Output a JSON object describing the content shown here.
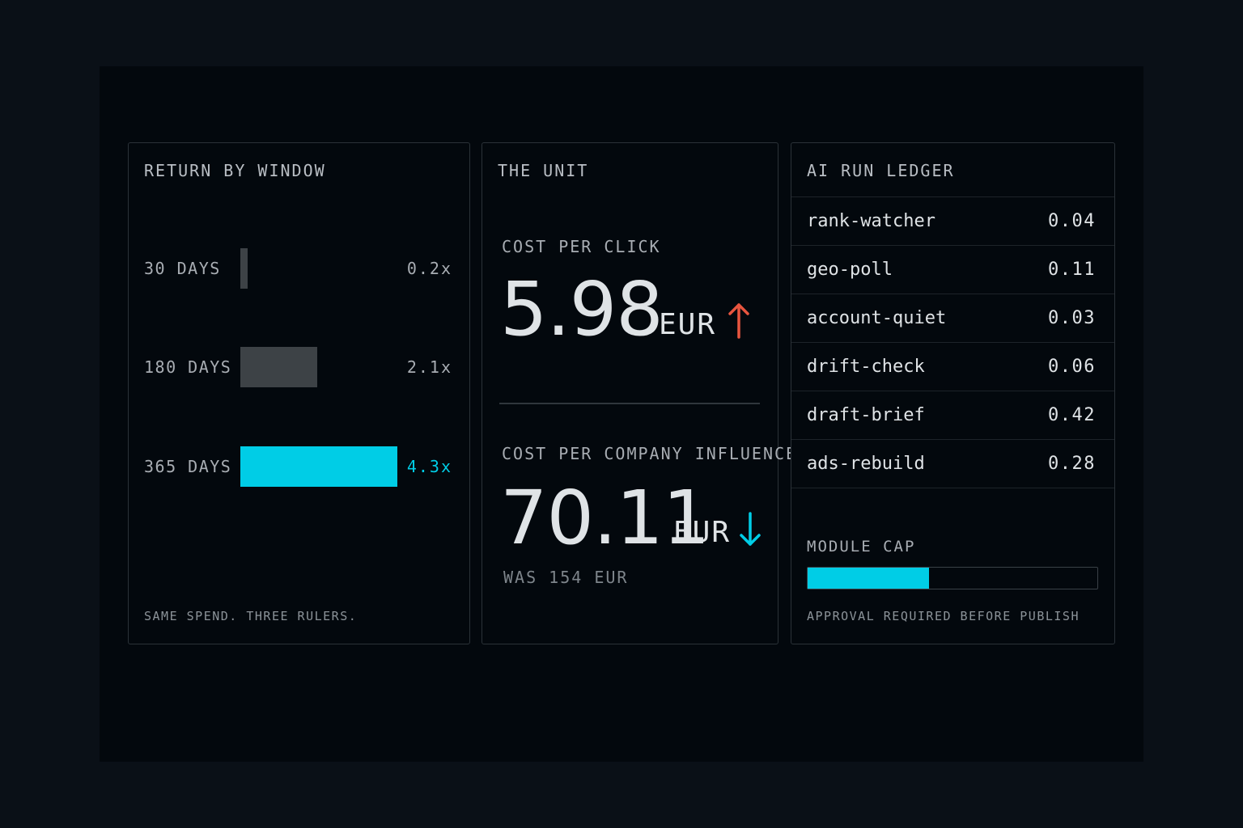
{
  "colors": {
    "accent": "#00cde6",
    "alert_up": "#e8553f",
    "bar_muted": "#3d4246"
  },
  "return_by_window": {
    "title": "RETURN BY WINDOW",
    "rows": [
      {
        "label": "30 DAYS",
        "value": "0.2x",
        "ratio": 0.2,
        "highlight": false
      },
      {
        "label": "180 DAYS",
        "value": "2.1x",
        "ratio": 2.1,
        "highlight": false
      },
      {
        "label": "365 DAYS",
        "value": "4.3x",
        "ratio": 4.3,
        "highlight": true
      }
    ],
    "footnote": "SAME SPEND. THREE RULERS."
  },
  "unit": {
    "title": "THE UNIT",
    "cost_per_click": {
      "label": "COST PER CLICK",
      "value": "5.98",
      "currency": "EUR",
      "trend": "up",
      "trend_icon": "arrow-up-icon"
    },
    "cost_per_company": {
      "label": "COST PER COMPANY INFLUENCED",
      "value": "70.11",
      "currency": "EUR",
      "trend": "down",
      "trend_icon": "arrow-down-icon",
      "previous": "WAS 154 EUR"
    }
  },
  "ledger": {
    "title": "AI RUN LEDGER",
    "rows": [
      {
        "name": "rank-watcher",
        "cost": "0.04"
      },
      {
        "name": "geo-poll",
        "cost": "0.11"
      },
      {
        "name": "account-quiet",
        "cost": "0.03"
      },
      {
        "name": "drift-check",
        "cost": "0.06"
      },
      {
        "name": "draft-brief",
        "cost": "0.42"
      },
      {
        "name": "ads-rebuild",
        "cost": "0.28"
      }
    ],
    "module_cap": {
      "label": "MODULE CAP",
      "fraction": 0.42,
      "note": "APPROVAL REQUIRED BEFORE PUBLISH"
    }
  }
}
